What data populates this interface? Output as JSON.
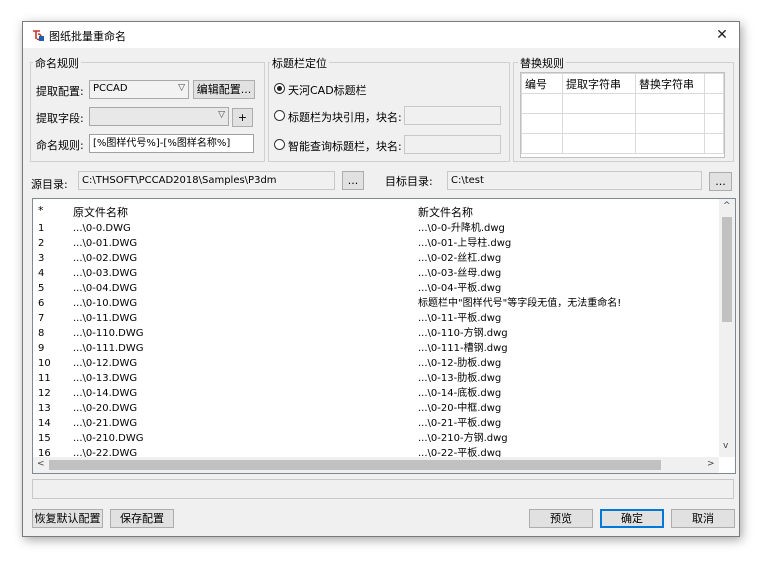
{
  "window": {
    "title": "图纸批量重命名",
    "close": "✕"
  },
  "naming": {
    "group_label": "命名规则",
    "config_label": "提取配置:",
    "config_value": "PCCAD",
    "edit_button": "编辑配置...",
    "field_label": "提取字段:",
    "field_value": "",
    "add_button": "+",
    "rule_label": "命名规则:",
    "rule_value": "[%图样代号%]-[%图样名称%]"
  },
  "titleblock": {
    "group_label": "标题栏定位",
    "options": [
      {
        "label": "天河CAD标题栏",
        "checked": true
      },
      {
        "label": "标题栏为块引用，块名:",
        "checked": false
      },
      {
        "label": "智能查询标题栏，块名:",
        "checked": false
      }
    ]
  },
  "replace": {
    "group_label": "替换规则",
    "headers": [
      "编号",
      "提取字符串",
      "替换字符串"
    ]
  },
  "paths": {
    "source_label": "源目录:",
    "source_value": "C:\\THSOFT\\PCCAD2018\\Samples\\P3dm",
    "browse": "...",
    "target_label": "目标目录:",
    "target_value": "C:\\test"
  },
  "list": {
    "headers": [
      "*",
      "原文件名称",
      "新文件名称"
    ],
    "rows": [
      [
        "1",
        "...\\0-0.DWG",
        "...\\0-0-升降机.dwg"
      ],
      [
        "2",
        "...\\0-01.DWG",
        "...\\0-01-上导柱.dwg"
      ],
      [
        "3",
        "...\\0-02.DWG",
        "...\\0-02-丝杠.dwg"
      ],
      [
        "4",
        "...\\0-03.DWG",
        "...\\0-03-丝母.dwg"
      ],
      [
        "5",
        "...\\0-04.DWG",
        "...\\0-04-平板.dwg"
      ],
      [
        "6",
        "...\\0-10.DWG",
        "标题栏中\"图样代号\"等字段无值，无法重命名!"
      ],
      [
        "7",
        "...\\0-11.DWG",
        "...\\0-11-平板.dwg"
      ],
      [
        "8",
        "...\\0-110.DWG",
        "...\\0-110-方钢.dwg"
      ],
      [
        "9",
        "...\\0-111.DWG",
        "...\\0-111-槽钢.dwg"
      ],
      [
        "10",
        "...\\0-12.DWG",
        "...\\0-12-肋板.dwg"
      ],
      [
        "11",
        "...\\0-13.DWG",
        "...\\0-13-肋板.dwg"
      ],
      [
        "12",
        "...\\0-14.DWG",
        "...\\0-14-底板.dwg"
      ],
      [
        "13",
        "...\\0-20.DWG",
        "...\\0-20-中框.dwg"
      ],
      [
        "14",
        "...\\0-21.DWG",
        "...\\0-21-平板.dwg"
      ],
      [
        "15",
        "...\\0-210.DWG",
        "...\\0-210-方钢.dwg"
      ],
      [
        "16",
        "...\\0-22.DWG",
        "...\\0-22-平板.dwg"
      ]
    ]
  },
  "buttons": {
    "restore": "恢复默认配置",
    "save": "保存配置",
    "preview": "预览",
    "ok": "确定",
    "cancel": "取消"
  },
  "colors": {
    "accent": "#0078d7",
    "dialog_bg": "#f0f0f0"
  },
  "icons": {
    "app": "drawing-app-icon",
    "close": "close-icon"
  }
}
